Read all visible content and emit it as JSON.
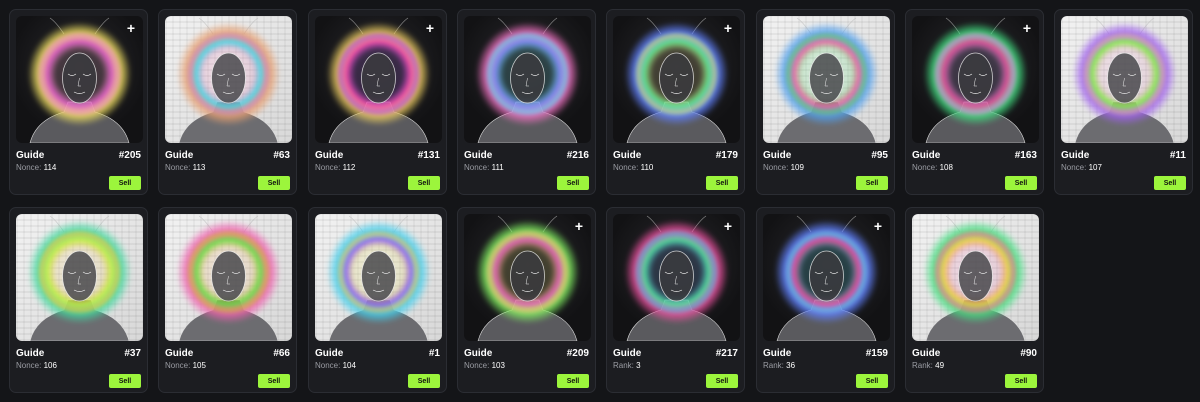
{
  "colors": {
    "background": "#141518",
    "card": "#1c1d21",
    "accent": "#9cf53c"
  },
  "cards": [
    {
      "name": "Guide",
      "number": "#205",
      "meta_label": "Nonce:",
      "meta_value": "114",
      "sell_label": "Sell",
      "theme": "dark",
      "plus": true,
      "halo": [
        "#e85fd0",
        "#f0e060",
        "#f7a0c0"
      ]
    },
    {
      "name": "Guide",
      "number": "#63",
      "meta_label": "Nonce:",
      "meta_value": "113",
      "sell_label": "Sell",
      "theme": "light",
      "plus": false,
      "halo": [
        "#40d8e8",
        "#e8a070",
        "#f070b0"
      ]
    },
    {
      "name": "Guide",
      "number": "#131",
      "meta_label": "Nonce:",
      "meta_value": "112",
      "sell_label": "Sell",
      "theme": "dark",
      "plus": true,
      "halo": [
        "#ff50b0",
        "#f0d060",
        "#b050f0"
      ]
    },
    {
      "name": "Guide",
      "number": "#216",
      "meta_label": "Nonce:",
      "meta_value": "111",
      "sell_label": "Sell",
      "theme": "dark",
      "plus": false,
      "halo": [
        "#8090ff",
        "#f070c0",
        "#60e8f0"
      ]
    },
    {
      "name": "Guide",
      "number": "#179",
      "meta_label": "Nonce:",
      "meta_value": "110",
      "sell_label": "Sell",
      "theme": "dark",
      "plus": true,
      "halo": [
        "#60f090",
        "#6080ff",
        "#f0e080"
      ]
    },
    {
      "name": "Guide",
      "number": "#95",
      "meta_label": "Nonce:",
      "meta_value": "109",
      "sell_label": "Sell",
      "theme": "light",
      "plus": false,
      "halo": [
        "#f060a0",
        "#50a0f0",
        "#40e060"
      ]
    },
    {
      "name": "Guide",
      "number": "#163",
      "meta_label": "Nonce:",
      "meta_value": "108",
      "sell_label": "Sell",
      "theme": "dark",
      "plus": true,
      "halo": [
        "#f050a0",
        "#40e080",
        "#d0a0f0"
      ]
    },
    {
      "name": "Guide",
      "number": "#11",
      "meta_label": "Nonce:",
      "meta_value": "107",
      "sell_label": "Sell",
      "theme": "light",
      "plus": false,
      "halo": [
        "#80f040",
        "#a060f0",
        "#f090c0"
      ]
    },
    {
      "name": "Guide",
      "number": "#37",
      "meta_label": "Nonce:",
      "meta_value": "106",
      "sell_label": "Sell",
      "theme": "light",
      "plus": false,
      "halo": [
        "#c0f040",
        "#40d8a0",
        "#f0c040"
      ]
    },
    {
      "name": "Guide",
      "number": "#66",
      "meta_label": "Nonce:",
      "meta_value": "105",
      "sell_label": "Sell",
      "theme": "light",
      "plus": false,
      "halo": [
        "#60e040",
        "#f060b0",
        "#f0a040"
      ]
    },
    {
      "name": "Guide",
      "number": "#1",
      "meta_label": "Nonce:",
      "meta_value": "104",
      "sell_label": "Sell",
      "theme": "light",
      "plus": false,
      "halo": [
        "#9060f0",
        "#40d0f0",
        "#f0e040"
      ]
    },
    {
      "name": "Guide",
      "number": "#209",
      "meta_label": "Nonce:",
      "meta_value": "103",
      "sell_label": "Sell",
      "theme": "dark",
      "plus": true,
      "halo": [
        "#f060c0",
        "#80f060",
        "#f0e060"
      ]
    },
    {
      "name": "Guide",
      "number": "#217",
      "meta_label": "Rank:",
      "meta_value": "3",
      "sell_label": "Sell",
      "theme": "dark",
      "plus": true,
      "halo": [
        "#50e8a0",
        "#f050a0",
        "#60a0f0"
      ]
    },
    {
      "name": "Guide",
      "number": "#159",
      "meta_label": "Rank:",
      "meta_value": "36",
      "sell_label": "Sell",
      "theme": "dark",
      "plus": true,
      "halo": [
        "#f050a0",
        "#6080ff",
        "#40e0f0"
      ]
    },
    {
      "name": "Guide",
      "number": "#90",
      "meta_label": "Rank:",
      "meta_value": "49",
      "sell_label": "Sell",
      "theme": "light",
      "plus": false,
      "halo": [
        "#f0d040",
        "#40e080",
        "#f060a0"
      ]
    }
  ]
}
